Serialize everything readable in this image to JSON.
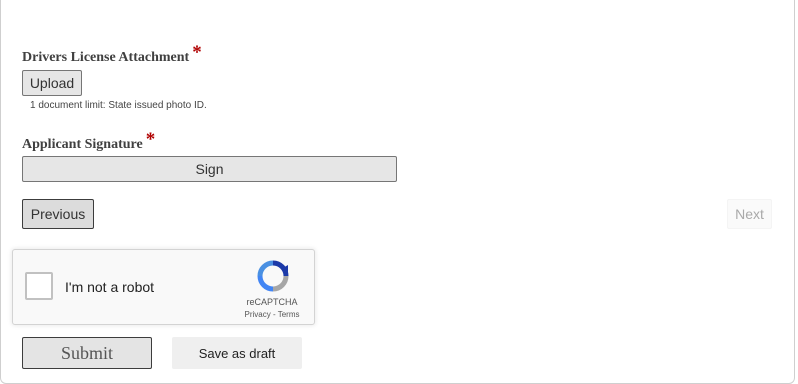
{
  "fields": {
    "license": {
      "label": "Drivers License Attachment",
      "required_mark": "*",
      "upload_label": "Upload",
      "hint": "1 document limit: State issued photo ID."
    },
    "signature": {
      "label": "Applicant Signature",
      "required_mark": "*",
      "sign_label": "Sign"
    }
  },
  "nav": {
    "previous_label": "Previous",
    "next_label": "Next"
  },
  "recaptcha": {
    "checkbox_label": "I'm not a robot",
    "brand": "reCAPTCHA",
    "privacy": "Privacy",
    "separator": " - ",
    "terms": "Terms",
    "checked": false
  },
  "actions": {
    "submit_label": "Submit",
    "draft_label": "Save as draft"
  },
  "colors": {
    "required": "#b00000",
    "button_bg": "#e6e6e6",
    "previous_bg": "#dcdcdc",
    "next_text": "#a9a9a9",
    "draft_bg": "#efefef"
  }
}
